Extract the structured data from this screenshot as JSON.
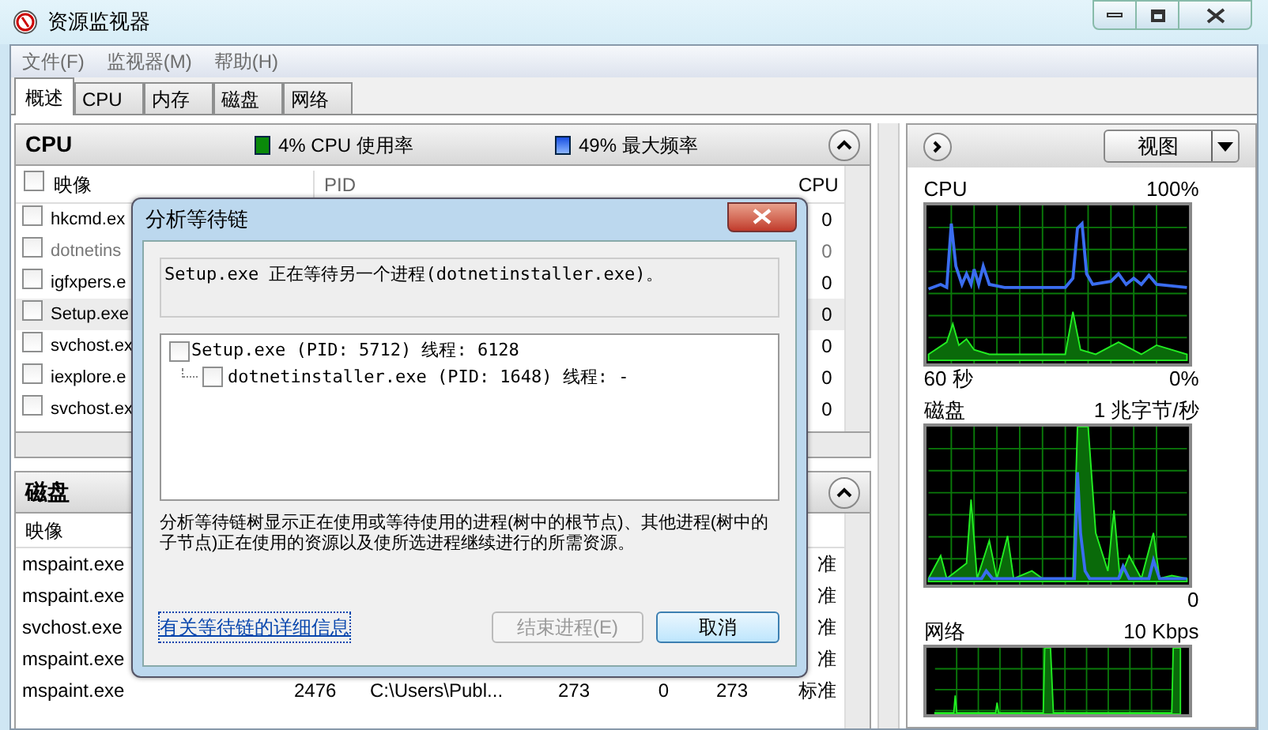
{
  "window": {
    "title": "资源监视器"
  },
  "menu": [
    "文件(F)",
    "监视器(M)",
    "帮助(H)"
  ],
  "tabs": [
    {
      "label": "概述",
      "selected": true
    },
    {
      "label": "CPU",
      "selected": false
    },
    {
      "label": "内存",
      "selected": false
    },
    {
      "label": "磁盘",
      "selected": false
    },
    {
      "label": "网络",
      "selected": false
    }
  ],
  "cpu_section": {
    "title": "CPU",
    "usage": "4% CPU 使用率",
    "frequency": "49% 最大频率",
    "expanded": true,
    "columns": [
      "映像",
      "PID",
      "CPU"
    ],
    "all_checked": false,
    "rows": [
      {
        "image": "hkcmd.ex",
        "cpu": "0",
        "checked": false,
        "selected": false,
        "disabled": false
      },
      {
        "image": "dotnetins",
        "cpu": "0",
        "checked": false,
        "selected": false,
        "disabled": true
      },
      {
        "image": "igfxpers.e",
        "cpu": "0",
        "checked": false,
        "selected": false,
        "disabled": false
      },
      {
        "image": "Setup.exe",
        "cpu": "0",
        "checked": false,
        "selected": true,
        "disabled": false
      },
      {
        "image": "svchost.ex",
        "cpu": "0",
        "checked": false,
        "selected": false,
        "disabled": false
      },
      {
        "image": "iexplore.e",
        "cpu": "0",
        "checked": false,
        "selected": false,
        "disabled": false
      },
      {
        "image": "svchost.ex",
        "cpu": "0",
        "checked": false,
        "selected": false,
        "disabled": false
      }
    ]
  },
  "disk_section": {
    "title": "磁盘",
    "expanded": true,
    "columns": [
      "映像"
    ],
    "rows": [
      {
        "cells": [
          "mspaint.exe",
          "",
          "",
          "",
          "",
          "",
          "准"
        ]
      },
      {
        "cells": [
          "mspaint.exe",
          "",
          "",
          "",
          "",
          "",
          "准"
        ]
      },
      {
        "cells": [
          "svchost.exe",
          "",
          "",
          "",
          "",
          "",
          "准"
        ]
      },
      {
        "cells": [
          "mspaint.exe",
          "",
          "",
          "",
          "",
          "",
          "准"
        ]
      },
      {
        "cells": [
          "mspaint.exe",
          "2476",
          "C:\\Users\\Publ...",
          "273",
          "0",
          "273",
          "标准"
        ]
      }
    ]
  },
  "right_pane": {
    "view_button": "视图",
    "graphs": [
      {
        "kind": "cpu",
        "title": "CPU",
        "max": "100%",
        "time": "60 秒",
        "min": "0%"
      },
      {
        "kind": "disk",
        "title": "磁盘",
        "max": "1 兆字节/秒",
        "min": "0"
      },
      {
        "kind": "network",
        "title": "网络",
        "max": "10 Kbps"
      }
    ]
  },
  "dialog": {
    "title": "分析等待链",
    "message": "Setup.exe 正在等待另一个进程(dotnetinstaller.exe)。",
    "tree": [
      {
        "label": "Setup.exe (PID: 5712) 线程: 6128",
        "checked": false,
        "children": [
          {
            "label": "dotnetinstaller.exe (PID: 1648) 线程: -",
            "checked": false
          }
        ]
      }
    ],
    "description": "分析等待链树显示正在使用或等待使用的进程(树中的根节点)、其他进程(树中的子节点)正在使用的资源以及使所选进程继续进行的所需资源。",
    "link": "有关等待链的详细信息",
    "buttons": [
      {
        "label": "结束进程(E)",
        "disabled": true
      },
      {
        "label": "取消",
        "disabled": false
      }
    ]
  }
}
